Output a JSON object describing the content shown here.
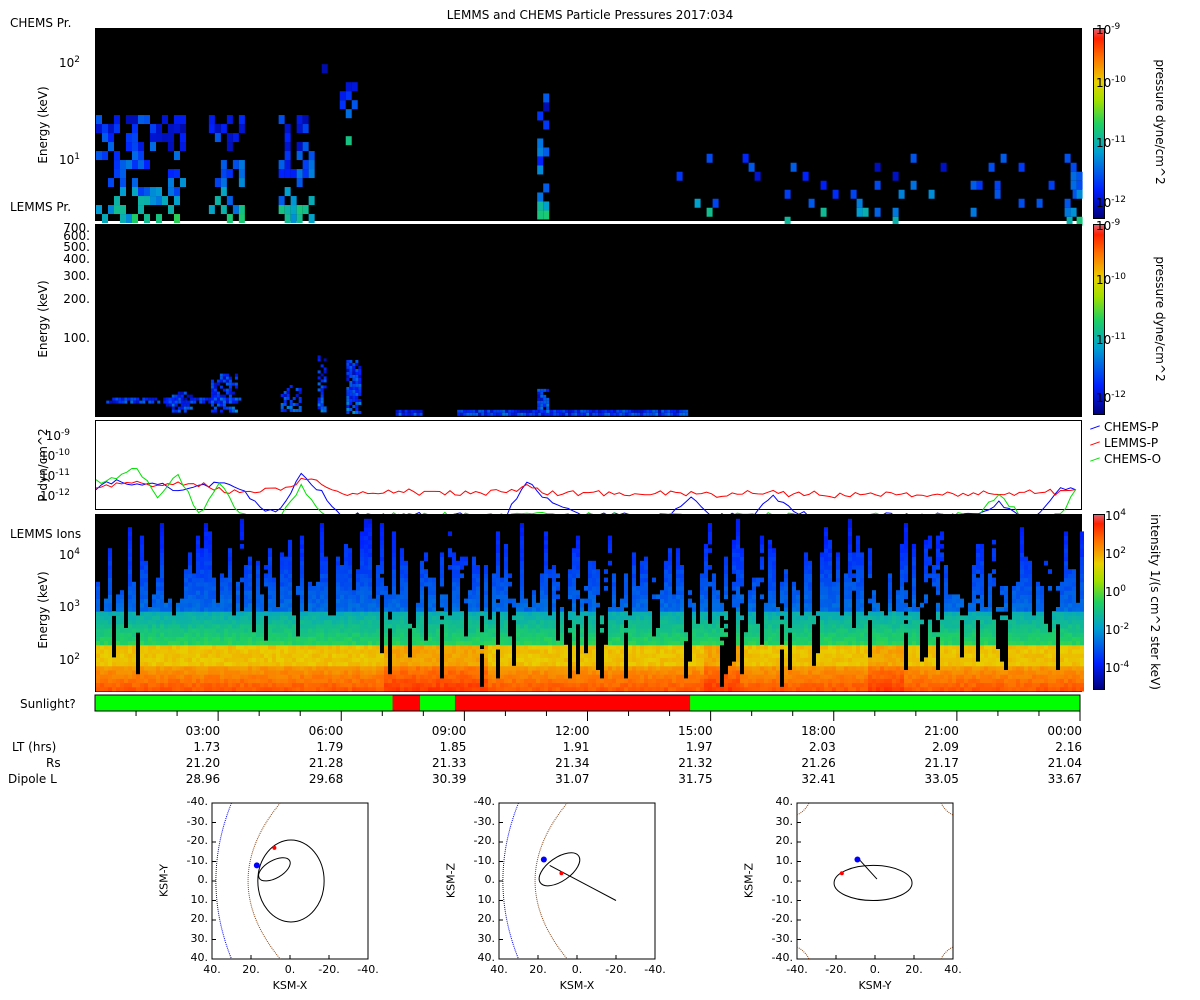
{
  "title": "LEMMS and CHEMS Particle Pressures  2017:034",
  "panels": {
    "chems": {
      "label": "CHEMS Pr.",
      "ylabel": "Energy (keV)",
      "yticks": [
        "10",
        "10"
      ],
      "yexp": [
        "2",
        "1"
      ],
      "cbar_label": "pressure dyne/cm^2",
      "cbar_ticks": [
        "10",
        "10",
        "10",
        "10"
      ],
      "cbar_exp": [
        "-9",
        "-10",
        "-11",
        "-12"
      ]
    },
    "lemms": {
      "label": "LEMMS Pr.",
      "ylabel": "Energy (keV)",
      "yticks": [
        "700.",
        "600.",
        "500.",
        "400.",
        "300.",
        "200.",
        "100."
      ],
      "cbar_label": "pressure dyne/cm^2",
      "cbar_ticks": [
        "10",
        "10",
        "10",
        "10"
      ],
      "cbar_exp": [
        "-9",
        "-10",
        "-11",
        "-12"
      ]
    },
    "pressure": {
      "ylabel": "P dyn/cm^2",
      "yticks": [
        "10",
        "10",
        "10",
        "10"
      ],
      "yexp": [
        "-9",
        "-10",
        "-11",
        "-12"
      ],
      "legend": [
        {
          "name": "CHEMS-P",
          "color": "#0000ff"
        },
        {
          "name": "LEMMS-P",
          "color": "#ff0000"
        },
        {
          "name": "CHEMS-O",
          "color": "#00e000"
        }
      ]
    },
    "ions": {
      "label": "LEMMS Ions",
      "ylabel": "Energy (keV)",
      "yticks": [
        "10",
        "10",
        "10"
      ],
      "yexp": [
        "4",
        "3",
        "2"
      ],
      "cbar_label": "intensity 1/(s cm^2 ster keV)",
      "cbar_ticks": [
        "10",
        "10",
        "10",
        "10",
        "10"
      ],
      "cbar_exp": [
        "4",
        "2",
        "0",
        "-2",
        "-4"
      ]
    },
    "sunlight": {
      "label": "Sunlight?",
      "colors": {
        "sun": "#00ff00",
        "shadow": "#ff0000"
      }
    }
  },
  "ephemeris": {
    "times": [
      "03:00",
      "06:00",
      "09:00",
      "12:00",
      "15:00",
      "18:00",
      "21:00",
      "00:00"
    ],
    "rows": [
      {
        "label": "LT (hrs)",
        "values": [
          "1.73",
          "1.79",
          "1.85",
          "1.91",
          "1.97",
          "2.03",
          "2.09",
          "2.16"
        ]
      },
      {
        "label": "Rs",
        "values": [
          "21.20",
          "21.28",
          "21.33",
          "21.34",
          "21.32",
          "21.26",
          "21.17",
          "21.04"
        ]
      },
      {
        "label": "Dipole L",
        "values": [
          "28.96",
          "29.68",
          "30.39",
          "31.07",
          "31.75",
          "32.41",
          "33.05",
          "33.67"
        ]
      }
    ]
  },
  "orbits": [
    {
      "xlabel": "KSM-X",
      "ylabel": "KSM-Y",
      "xticks": [
        "40.",
        "20.",
        "0.",
        "-20.",
        "-40."
      ],
      "yticks": [
        "-40.",
        "-30.",
        "-20.",
        "-10.",
        "0.",
        "10.",
        "20.",
        "30.",
        "40."
      ]
    },
    {
      "xlabel": "KSM-X",
      "ylabel": "KSM-Z",
      "xticks": [
        "40.",
        "20.",
        "0.",
        "-20.",
        "-40."
      ],
      "yticks": [
        "-40.",
        "-30.",
        "-20.",
        "-10.",
        "0.",
        "10.",
        "20.",
        "30.",
        "40."
      ]
    },
    {
      "xlabel": "KSM-Y",
      "ylabel": "KSM-Z",
      "xticks": [
        "-40.",
        "-20.",
        "0.",
        "20.",
        "40."
      ],
      "yticks": [
        "40.",
        "30.",
        "20.",
        "10.",
        "0.",
        "-10.",
        "-20.",
        "-30.",
        "-40."
      ]
    }
  ],
  "chart_data": [
    {
      "type": "heatmap",
      "name": "CHEMS pressure spectrogram",
      "x_range_hours": [
        0,
        24
      ],
      "ylim_keV": [
        2.5,
        230
      ],
      "yscale": "log",
      "zlim": [
        1e-12,
        1e-09
      ],
      "events": [
        {
          "t": [
            0,
            2.1
          ],
          "e": [
            2.5,
            30
          ],
          "density": 0.5
        },
        {
          "t": [
            2.75,
            3.6
          ],
          "e": [
            2.5,
            30
          ],
          "density": 0.55
        },
        {
          "t": [
            4.45,
            5.2
          ],
          "e": [
            2.5,
            30
          ],
          "density": 0.6
        },
        {
          "t": [
            5.5,
            6.3
          ],
          "e": [
            15,
            100
          ],
          "density": 0.2
        },
        {
          "t": [
            10.75,
            10.95
          ],
          "e": [
            2.5,
            50
          ],
          "density": 0.6
        },
        {
          "t": [
            14,
            24
          ],
          "e": [
            2.5,
            12
          ],
          "density": 0.05
        },
        {
          "t": [
            23.6,
            24
          ],
          "e": [
            2.5,
            12
          ],
          "density": 0.6
        }
      ]
    },
    {
      "type": "heatmap",
      "name": "LEMMS pressure spectrogram",
      "x_range_hours": [
        0,
        24
      ],
      "ylim_keV": [
        26,
        760
      ],
      "yscale": "log",
      "zlim": [
        1e-12,
        1e-09
      ],
      "events": [
        {
          "t": [
            0.25,
            3.5
          ],
          "e": [
            33,
            36
          ],
          "density": 0.8
        },
        {
          "t": [
            1.7,
            2.3
          ],
          "e": [
            28,
            40
          ],
          "density": 0.6
        },
        {
          "t": [
            2.8,
            3.4
          ],
          "e": [
            28,
            55
          ],
          "density": 0.7
        },
        {
          "t": [
            4.5,
            5.0
          ],
          "e": [
            28,
            45
          ],
          "density": 0.6
        },
        {
          "t": [
            5.4,
            5.6
          ],
          "e": [
            28,
            80
          ],
          "density": 0.5
        },
        {
          "t": [
            6.1,
            6.4
          ],
          "e": [
            28,
            70
          ],
          "density": 0.8
        },
        {
          "t": [
            7.3,
            7.9
          ],
          "e": [
            27,
            29
          ],
          "density": 1
        },
        {
          "t": [
            8.8,
            14.4
          ],
          "e": [
            27,
            29
          ],
          "density": 1
        },
        {
          "t": [
            10.75,
            11.0
          ],
          "e": [
            28,
            42
          ],
          "density": 0.8
        }
      ]
    },
    {
      "type": "line",
      "name": "Particle pressures",
      "xlabel": "",
      "ylabel": "P dyn/cm^2",
      "yscale": "log",
      "ylim": [
        6e-13,
        6e-09
      ],
      "x_hours_step": 0.5,
      "series": [
        {
          "name": "CHEMS-P",
          "log10_values": [
            -11.3,
            -10.9,
            -11.1,
            -11.0,
            -11.4,
            -11.2,
            -11.0,
            -11.3,
            -12.2,
            -12.3,
            -10.6,
            -11.5,
            -12.5,
            -12.5,
            -12.5,
            -12.5,
            -12.5,
            -12.5,
            -12.5,
            -12.5,
            -12.5,
            -11.0,
            -11.8,
            -12.3,
            -12.5,
            -12.5,
            -12.5,
            -12.5,
            -12.5,
            -11.7,
            -12.5,
            -12.5,
            -12.5,
            -11.6,
            -12.3,
            -12.5,
            -12.5,
            -12.5,
            -12.5,
            -12.5,
            -12.5,
            -12.5,
            -12.5,
            -12.5,
            -11.9,
            -12.5,
            -12.5,
            -11.2,
            -11.4
          ]
        },
        {
          "name": "LEMMS-P",
          "log10_values": [
            -11.2,
            -11.1,
            -11.0,
            -11.2,
            -11.0,
            -11.1,
            -11.3,
            -11.5,
            -11.4,
            -11.3,
            -10.9,
            -11.0,
            -11.6,
            -11.5,
            -11.5,
            -11.4,
            -11.5,
            -11.5,
            -11.5,
            -11.5,
            -11.4,
            -11.2,
            -11.5,
            -11.5,
            -11.5,
            -11.5,
            -11.5,
            -11.5,
            -11.5,
            -11.5,
            -11.6,
            -11.5,
            -11.4,
            -11.5,
            -11.6,
            -11.5,
            -11.6,
            -11.6,
            -11.5,
            -11.6,
            -11.6,
            -11.5,
            -11.6,
            -11.5,
            -11.5,
            -11.5,
            -11.4,
            -11.5,
            -11.2
          ]
        },
        {
          "name": "CHEMS-O",
          "log10_values": [
            -11.0,
            -10.8,
            -10.4,
            -11.6,
            -10.6,
            -12.5,
            -11.0,
            -12.5,
            -12.5,
            -12.5,
            -11.2,
            -12.5,
            -12.5,
            -12.5,
            -12.5,
            -12.5,
            -12.5,
            -12.5,
            -12.5,
            -12.5,
            -12.5,
            -12.5,
            -12.5,
            -12.5,
            -12.5,
            -12.5,
            -12.5,
            -12.5,
            -12.5,
            -12.5,
            -12.5,
            -12.5,
            -12.5,
            -12.5,
            -12.5,
            -12.5,
            -12.5,
            -12.5,
            -12.5,
            -12.5,
            -12.5,
            -12.5,
            -12.5,
            -12.5,
            -11.5,
            -12.5,
            -12.5,
            -12.5,
            -11.0
          ]
        }
      ]
    },
    {
      "type": "heatmap",
      "name": "LEMMS ion intensity",
      "x_range_hours": [
        0,
        24
      ],
      "ylim_keV": [
        28,
        63000
      ],
      "yscale": "log",
      "zlim": [
        3e-05,
        10000.0
      ]
    },
    {
      "type": "timeline",
      "name": "Sunlight",
      "shadow_intervals_hours": [
        [
          7.25,
          7.92
        ],
        [
          8.77,
          14.5
        ]
      ]
    }
  ]
}
